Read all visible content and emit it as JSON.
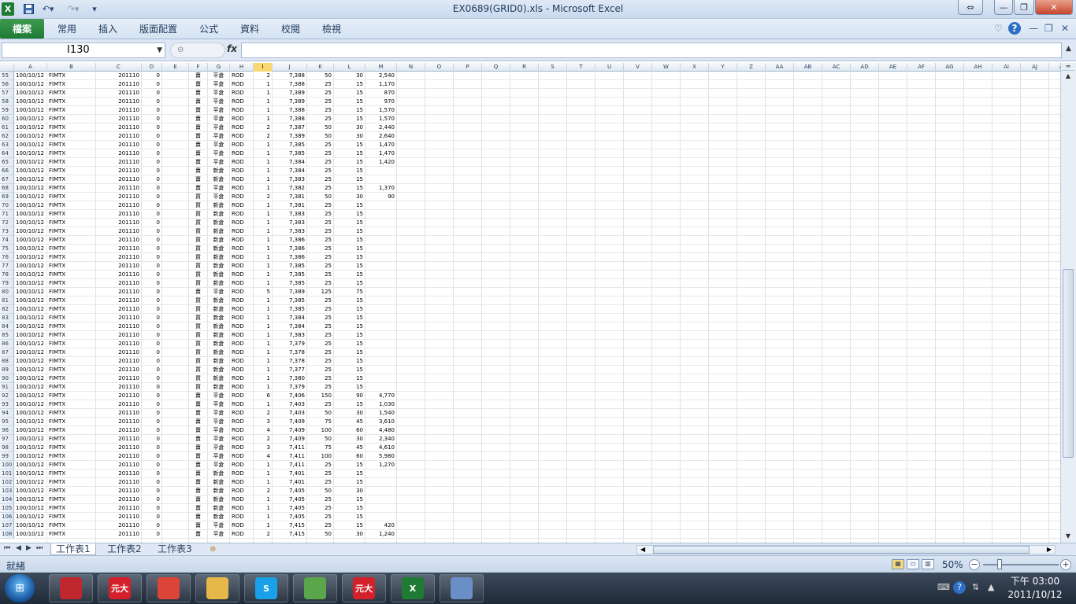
{
  "window": {
    "title": "EX0689(GRID0).xls  -  Microsoft Excel"
  },
  "ribbon": {
    "file_tab": "檔案",
    "tabs": [
      "常用",
      "插入",
      "版面配置",
      "公式",
      "資料",
      "校閱",
      "檢視"
    ]
  },
  "formula_bar": {
    "name_box": "I130",
    "fx": "fx",
    "formula": ""
  },
  "columns": [
    "A",
    "B",
    "C",
    "D",
    "E",
    "F",
    "G",
    "H",
    "I",
    "J",
    "K",
    "L",
    "M",
    "N",
    "O",
    "P",
    "Q",
    "R",
    "S",
    "T",
    "U",
    "V",
    "W",
    "X",
    "Y",
    "Z",
    "AA",
    "AB",
    "AC",
    "AD",
    "AE",
    "AF",
    "AG",
    "AH",
    "AI",
    "AJ",
    "AK"
  ],
  "selected_column": "I",
  "rows": [
    [
      "55",
      "100/10/12",
      "FIMTX",
      "201110",
      "0",
      "",
      "賣",
      "平倉",
      "ROD",
      "2",
      "7,388",
      "50",
      "30",
      "2,540"
    ],
    [
      "56",
      "100/10/12",
      "FIMTX",
      "201110",
      "0",
      "",
      "賣",
      "平倉",
      "ROD",
      "1",
      "7,388",
      "25",
      "15",
      "1,170"
    ],
    [
      "57",
      "100/10/12",
      "FIMTX",
      "201110",
      "0",
      "",
      "賣",
      "平倉",
      "ROD",
      "1",
      "7,389",
      "25",
      "15",
      "870"
    ],
    [
      "58",
      "100/10/12",
      "FIMTX",
      "201110",
      "0",
      "",
      "賣",
      "平倉",
      "ROD",
      "1",
      "7,389",
      "25",
      "15",
      "970"
    ],
    [
      "59",
      "100/10/12",
      "FIMTX",
      "201110",
      "0",
      "",
      "賣",
      "平倉",
      "ROD",
      "1",
      "7,388",
      "25",
      "15",
      "1,570"
    ],
    [
      "60",
      "100/10/12",
      "FIMTX",
      "201110",
      "0",
      "",
      "賣",
      "平倉",
      "ROD",
      "1",
      "7,388",
      "25",
      "15",
      "1,570"
    ],
    [
      "61",
      "100/10/12",
      "FIMTX",
      "201110",
      "0",
      "",
      "賣",
      "平倉",
      "ROD",
      "2",
      "7,387",
      "50",
      "30",
      "2,440"
    ],
    [
      "62",
      "100/10/12",
      "FIMTX",
      "201110",
      "0",
      "",
      "賣",
      "平倉",
      "ROD",
      "2",
      "7,389",
      "50",
      "30",
      "2,640"
    ],
    [
      "63",
      "100/10/12",
      "FIMTX",
      "201110",
      "0",
      "",
      "賣",
      "平倉",
      "ROD",
      "1",
      "7,385",
      "25",
      "15",
      "1,470"
    ],
    [
      "64",
      "100/10/12",
      "FIMTX",
      "201110",
      "0",
      "",
      "賣",
      "平倉",
      "ROD",
      "1",
      "7,385",
      "25",
      "15",
      "1,470"
    ],
    [
      "65",
      "100/10/12",
      "FIMTX",
      "201110",
      "0",
      "",
      "賣",
      "平倉",
      "ROD",
      "1",
      "7,384",
      "25",
      "15",
      "1,420"
    ],
    [
      "66",
      "100/10/12",
      "FIMTX",
      "201110",
      "0",
      "",
      "賣",
      "新倉",
      "ROD",
      "1",
      "7,384",
      "25",
      "15",
      ""
    ],
    [
      "67",
      "100/10/12",
      "FIMTX",
      "201110",
      "0",
      "",
      "賣",
      "新倉",
      "ROD",
      "1",
      "7,383",
      "25",
      "15",
      ""
    ],
    [
      "68",
      "100/10/12",
      "FIMTX",
      "201110",
      "0",
      "",
      "賣",
      "平倉",
      "ROD",
      "1",
      "7,382",
      "25",
      "15",
      "1,370"
    ],
    [
      "69",
      "100/10/12",
      "FIMTX",
      "201110",
      "0",
      "",
      "買",
      "平倉",
      "ROD",
      "2",
      "7,381",
      "50",
      "30",
      "90"
    ],
    [
      "70",
      "100/10/12",
      "FIMTX",
      "201110",
      "0",
      "",
      "買",
      "新倉",
      "ROD",
      "1",
      "7,381",
      "25",
      "15",
      ""
    ],
    [
      "71",
      "100/10/12",
      "FIMTX",
      "201110",
      "0",
      "",
      "買",
      "新倉",
      "ROD",
      "1",
      "7,383",
      "25",
      "15",
      ""
    ],
    [
      "72",
      "100/10/12",
      "FIMTX",
      "201110",
      "0",
      "",
      "買",
      "新倉",
      "ROD",
      "1",
      "7,383",
      "25",
      "15",
      ""
    ],
    [
      "73",
      "100/10/12",
      "FIMTX",
      "201110",
      "0",
      "",
      "買",
      "新倉",
      "ROD",
      "1",
      "7,383",
      "25",
      "15",
      ""
    ],
    [
      "74",
      "100/10/12",
      "FIMTX",
      "201110",
      "0",
      "",
      "買",
      "新倉",
      "ROD",
      "1",
      "7,386",
      "25",
      "15",
      ""
    ],
    [
      "75",
      "100/10/12",
      "FIMTX",
      "201110",
      "0",
      "",
      "買",
      "新倉",
      "ROD",
      "1",
      "7,386",
      "25",
      "15",
      ""
    ],
    [
      "76",
      "100/10/12",
      "FIMTX",
      "201110",
      "0",
      "",
      "買",
      "新倉",
      "ROD",
      "1",
      "7,386",
      "25",
      "15",
      ""
    ],
    [
      "77",
      "100/10/12",
      "FIMTX",
      "201110",
      "0",
      "",
      "買",
      "新倉",
      "ROD",
      "1",
      "7,385",
      "25",
      "15",
      ""
    ],
    [
      "78",
      "100/10/12",
      "FIMTX",
      "201110",
      "0",
      "",
      "買",
      "新倉",
      "ROD",
      "1",
      "7,385",
      "25",
      "15",
      ""
    ],
    [
      "79",
      "100/10/12",
      "FIMTX",
      "201110",
      "0",
      "",
      "買",
      "新倉",
      "ROD",
      "1",
      "7,385",
      "25",
      "15",
      ""
    ],
    [
      "80",
      "100/10/12",
      "FIMTX",
      "201110",
      "0",
      "",
      "賣",
      "平倉",
      "ROD",
      "5",
      "7,389",
      "125",
      "75",
      ""
    ],
    [
      "81",
      "100/10/12",
      "FIMTX",
      "201110",
      "0",
      "",
      "買",
      "新倉",
      "ROD",
      "1",
      "7,385",
      "25",
      "15",
      ""
    ],
    [
      "82",
      "100/10/12",
      "FIMTX",
      "201110",
      "0",
      "",
      "買",
      "新倉",
      "ROD",
      "1",
      "7,385",
      "25",
      "15",
      ""
    ],
    [
      "83",
      "100/10/12",
      "FIMTX",
      "201110",
      "0",
      "",
      "買",
      "新倉",
      "ROD",
      "1",
      "7,384",
      "25",
      "15",
      ""
    ],
    [
      "84",
      "100/10/12",
      "FIMTX",
      "201110",
      "0",
      "",
      "買",
      "新倉",
      "ROD",
      "1",
      "7,384",
      "25",
      "15",
      ""
    ],
    [
      "85",
      "100/10/12",
      "FIMTX",
      "201110",
      "0",
      "",
      "買",
      "新倉",
      "ROD",
      "1",
      "7,383",
      "25",
      "15",
      ""
    ],
    [
      "86",
      "100/10/12",
      "FIMTX",
      "201110",
      "0",
      "",
      "買",
      "新倉",
      "ROD",
      "1",
      "7,379",
      "25",
      "15",
      ""
    ],
    [
      "87",
      "100/10/12",
      "FIMTX",
      "201110",
      "0",
      "",
      "買",
      "新倉",
      "ROD",
      "1",
      "7,378",
      "25",
      "15",
      ""
    ],
    [
      "88",
      "100/10/12",
      "FIMTX",
      "201110",
      "0",
      "",
      "買",
      "新倉",
      "ROD",
      "1",
      "7,378",
      "25",
      "15",
      ""
    ],
    [
      "89",
      "100/10/12",
      "FIMTX",
      "201110",
      "0",
      "",
      "買",
      "新倉",
      "ROD",
      "1",
      "7,377",
      "25",
      "15",
      ""
    ],
    [
      "90",
      "100/10/12",
      "FIMTX",
      "201110",
      "0",
      "",
      "買",
      "新倉",
      "ROD",
      "1",
      "7,380",
      "25",
      "15",
      ""
    ],
    [
      "91",
      "100/10/12",
      "FIMTX",
      "201110",
      "0",
      "",
      "買",
      "新倉",
      "ROD",
      "1",
      "7,379",
      "25",
      "15",
      ""
    ],
    [
      "92",
      "100/10/12",
      "FIMTX",
      "201110",
      "0",
      "",
      "賣",
      "平倉",
      "ROD",
      "6",
      "7,406",
      "150",
      "90",
      "4,770"
    ],
    [
      "93",
      "100/10/12",
      "FIMTX",
      "201110",
      "0",
      "",
      "賣",
      "平倉",
      "ROD",
      "1",
      "7,403",
      "25",
      "15",
      "1,030"
    ],
    [
      "94",
      "100/10/12",
      "FIMTX",
      "201110",
      "0",
      "",
      "賣",
      "平倉",
      "ROD",
      "2",
      "7,403",
      "50",
      "30",
      "1,540"
    ],
    [
      "95",
      "100/10/12",
      "FIMTX",
      "201110",
      "0",
      "",
      "賣",
      "平倉",
      "ROD",
      "3",
      "7,409",
      "75",
      "45",
      "3,610"
    ],
    [
      "96",
      "100/10/12",
      "FIMTX",
      "201110",
      "0",
      "",
      "賣",
      "平倉",
      "ROD",
      "4",
      "7,409",
      "100",
      "60",
      "4,480"
    ],
    [
      "97",
      "100/10/12",
      "FIMTX",
      "201110",
      "0",
      "",
      "賣",
      "平倉",
      "ROD",
      "2",
      "7,409",
      "50",
      "30",
      "2,340"
    ],
    [
      "98",
      "100/10/12",
      "FIMTX",
      "201110",
      "0",
      "",
      "賣",
      "平倉",
      "ROD",
      "3",
      "7,411",
      "75",
      "45",
      "4,610"
    ],
    [
      "99",
      "100/10/12",
      "FIMTX",
      "201110",
      "0",
      "",
      "賣",
      "平倉",
      "ROD",
      "4",
      "7,411",
      "100",
      "60",
      "5,980"
    ],
    [
      "100",
      "100/10/12",
      "FIMTX",
      "201110",
      "0",
      "",
      "賣",
      "平倉",
      "ROD",
      "1",
      "7,411",
      "25",
      "15",
      "1,270"
    ],
    [
      "101",
      "100/10/12",
      "FIMTX",
      "201110",
      "0",
      "",
      "賣",
      "新倉",
      "ROD",
      "1",
      "7,401",
      "25",
      "15",
      ""
    ],
    [
      "102",
      "100/10/12",
      "FIMTX",
      "201110",
      "0",
      "",
      "賣",
      "新倉",
      "ROD",
      "1",
      "7,401",
      "25",
      "15",
      ""
    ],
    [
      "103",
      "100/10/12",
      "FIMTX",
      "201110",
      "0",
      "",
      "賣",
      "新倉",
      "ROD",
      "2",
      "7,405",
      "50",
      "30",
      ""
    ],
    [
      "104",
      "100/10/12",
      "FIMTX",
      "201110",
      "0",
      "",
      "賣",
      "新倉",
      "ROD",
      "1",
      "7,405",
      "25",
      "15",
      ""
    ],
    [
      "105",
      "100/10/12",
      "FIMTX",
      "201110",
      "0",
      "",
      "賣",
      "新倉",
      "ROD",
      "1",
      "7,405",
      "25",
      "15",
      ""
    ],
    [
      "106",
      "100/10/12",
      "FIMTX",
      "201110",
      "0",
      "",
      "賣",
      "新倉",
      "ROD",
      "1",
      "7,405",
      "25",
      "15",
      ""
    ],
    [
      "107",
      "100/10/12",
      "FIMTX",
      "201110",
      "0",
      "",
      "賣",
      "平倉",
      "ROD",
      "1",
      "7,415",
      "25",
      "15",
      "420"
    ],
    [
      "108",
      "100/10/12",
      "FIMTX",
      "201110",
      "0",
      "",
      "賣",
      "平倉",
      "ROD",
      "2",
      "7,415",
      "50",
      "30",
      "1,240"
    ]
  ],
  "sheets": [
    "工作表1",
    "工作表2",
    "工作表3"
  ],
  "active_sheet": 0,
  "status": {
    "ready": "就緒",
    "zoom": "50%"
  },
  "taskbar": {
    "apps": [
      {
        "icon": "dots-app-icon",
        "label": "",
        "color": "#c0262d"
      },
      {
        "icon": "yuanta-icon",
        "label": "元大",
        "color": "#d4202a"
      },
      {
        "icon": "chrome-icon",
        "label": "",
        "color": "#db4437"
      },
      {
        "icon": "folder-icon",
        "label": "",
        "color": "#e6b84a"
      },
      {
        "icon": "skype-icon",
        "label": "S",
        "color": "#1aa0e8"
      },
      {
        "icon": "people-icon",
        "label": "",
        "color": "#5aa64b"
      },
      {
        "icon": "yuanta-icon",
        "label": "元大",
        "color": "#d4202a"
      },
      {
        "icon": "excel-icon",
        "label": "X",
        "color": "#1f7a34"
      },
      {
        "icon": "paint-icon",
        "label": "",
        "color": "#6a8fc7"
      }
    ],
    "clock_time": "下午 03:00",
    "clock_date": "2011/10/12"
  }
}
